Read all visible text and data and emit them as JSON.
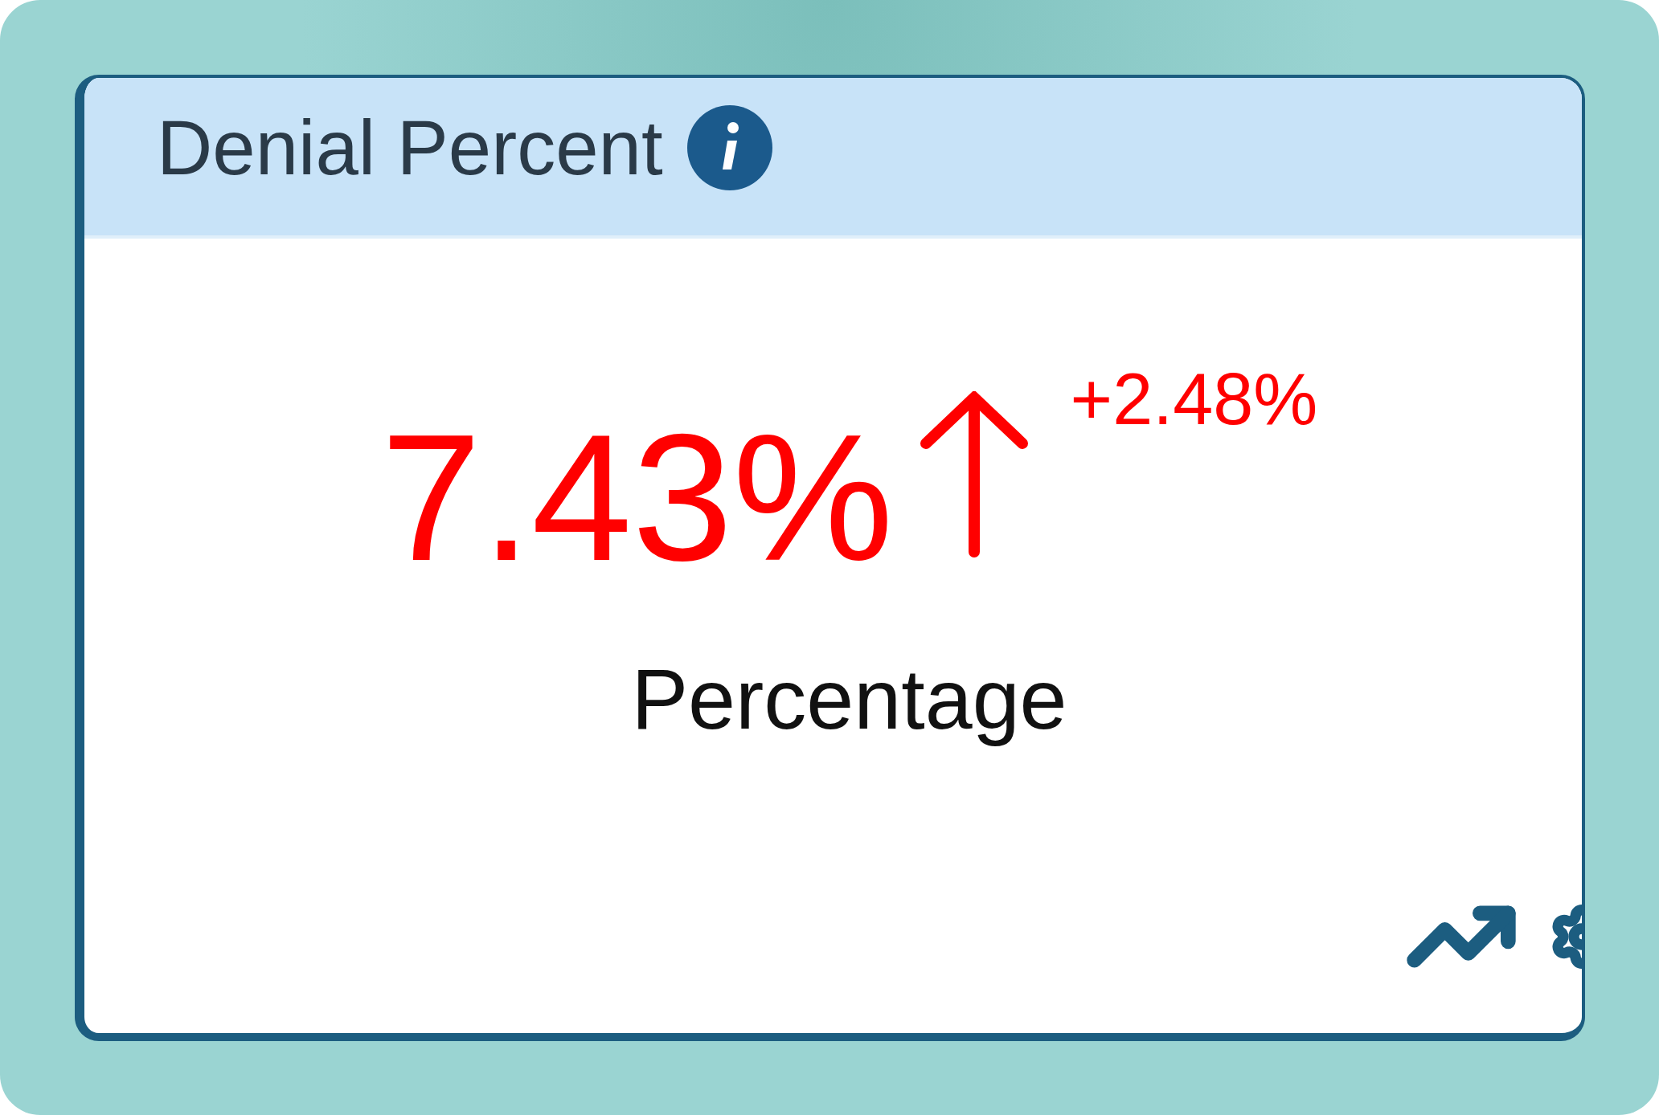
{
  "widget": {
    "title": "Denial Percent",
    "value": "7.43%",
    "change": {
      "text": "+2.48%",
      "increase": true
    },
    "unit_label": "Percentage"
  }
}
